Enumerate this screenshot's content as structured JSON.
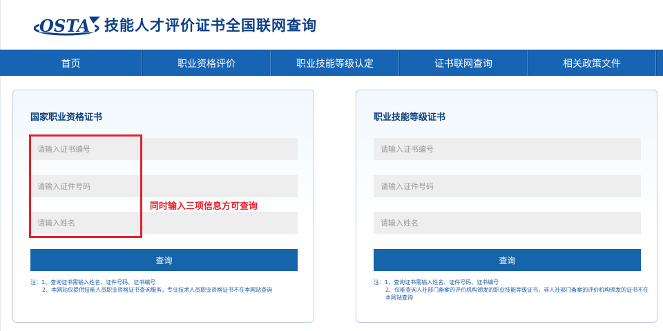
{
  "header": {
    "logo_text": "OSTA",
    "title": "技能人才评价证书全国联网查询"
  },
  "nav": {
    "items": [
      {
        "label": "首页"
      },
      {
        "label": "职业资格评价"
      },
      {
        "label": "职业技能等级认定"
      },
      {
        "label": "证书联网查询"
      },
      {
        "label": "相关政策文件"
      }
    ]
  },
  "left_card": {
    "title": "国家职业资格证书",
    "cert_no_placeholder": "请输入证书编号",
    "id_no_placeholder": "请输入证件号码",
    "name_placeholder": "请输入姓名",
    "query_label": "查询",
    "note_1": "注：1、查询证书需输入姓名、证件号码、证书编号",
    "note_2": "2、本网站仅提供技能人员职业资格证书查询服务，专业技术人员职业资格证书不在本网站查询"
  },
  "right_card": {
    "title": "职业技能等级证书",
    "cert_no_placeholder": "请输入证书编号",
    "id_no_placeholder": "请输入证件号码",
    "name_placeholder": "请输入姓名",
    "query_label": "查询",
    "note_1": "注：1、查询证书需输入姓名、证件号码、证书编号",
    "note_2": "2、仅能查询人社部门备案的评价机构颁发的职业技能等级证书，非人社部门备案的评价机构颁发的证书不在本网站查询"
  },
  "annotation": {
    "text": "同时输入三项信息方可查询",
    "color": "#e4202b"
  },
  "colors": {
    "nav_bg": "#1764b4",
    "brand_blue": "#0c3f86",
    "button_bg": "#1664ab",
    "note_text": "#1d5cab"
  }
}
